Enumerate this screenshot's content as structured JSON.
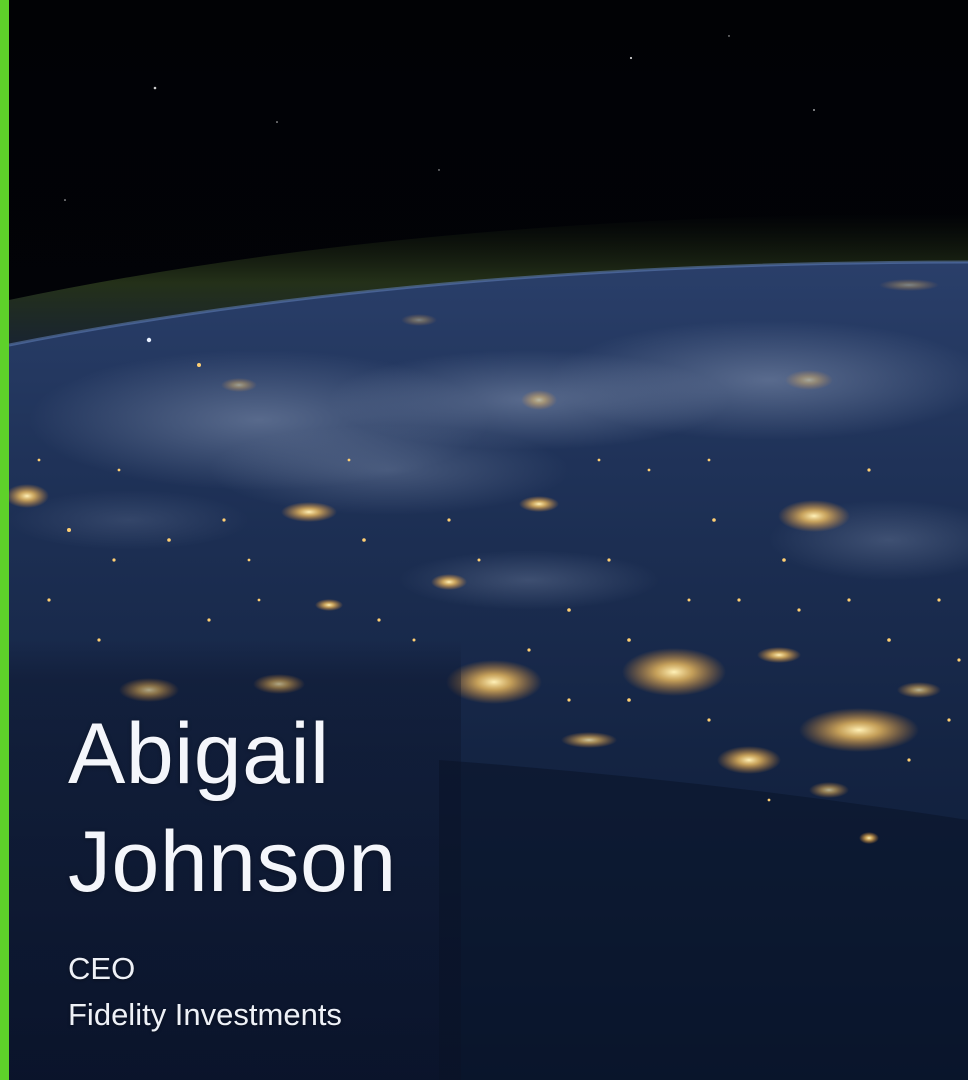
{
  "person": {
    "first_name": "Abigail",
    "last_name": "Johnson",
    "title": "CEO",
    "company": "Fidelity Investments"
  },
  "background": {
    "subject": "Earth at night seen from orbit with city lights"
  },
  "colors": {
    "accent": "#5ed12a",
    "text": "#f4f6fb",
    "space": "#02030a",
    "city_lights": "#ffd27a"
  }
}
